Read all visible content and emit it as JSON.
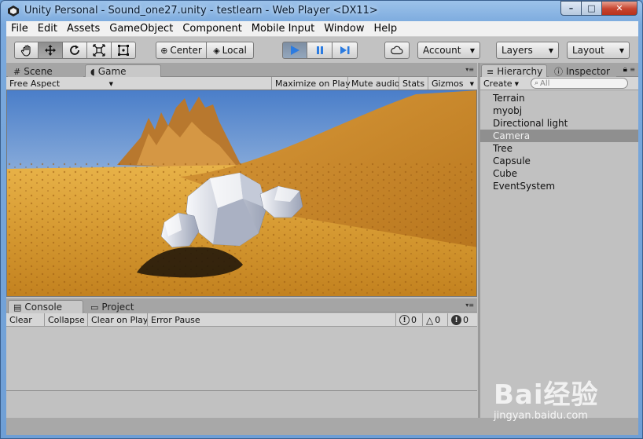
{
  "window": {
    "title": "Unity Personal - Sound_one27.unity - testlearn - Web Player <DX11>",
    "controls": {
      "minimize": "–",
      "maximize": "□",
      "close": "✕"
    }
  },
  "menu": [
    "File",
    "Edit",
    "Assets",
    "GameObject",
    "Component",
    "Mobile Input",
    "Window",
    "Help"
  ],
  "toolbar": {
    "tools": [
      "hand-icon",
      "move-icon",
      "rotate-icon",
      "scale-icon",
      "rect-tool-icon"
    ],
    "pivot_center": "Center",
    "pivot_local": "Local",
    "play_controls": [
      "play-icon",
      "pause-icon",
      "step-icon"
    ],
    "account": "Account",
    "layers": "Layers",
    "layout": "Layout"
  },
  "center_tabs": {
    "scene": "Scene",
    "game": "Game"
  },
  "game_bar": {
    "aspect": "Free Aspect",
    "maximize_on_play": "Maximize on Play",
    "mute_audio": "Mute audio",
    "stats": "Stats",
    "gizmos": "Gizmos"
  },
  "right_tabs": {
    "hierarchy": "Hierarchy",
    "inspector": "Inspector"
  },
  "hierarchy": {
    "create": "Create",
    "search_placeholder": "All",
    "items": [
      "Terrain",
      "myobj",
      "Directional light",
      "Camera",
      "Tree",
      "Capsule",
      "Cube",
      "EventSystem"
    ],
    "selected": "Camera"
  },
  "bottom_tabs": {
    "console": "Console",
    "project": "Project"
  },
  "console_bar": {
    "clear": "Clear",
    "collapse": "Collapse",
    "clear_on_play": "Clear on Play",
    "error_pause": "Error Pause",
    "info_count": "0",
    "warning_count": "0",
    "error_count": "0"
  },
  "watermark": {
    "brand": "Bai经验",
    "url": "jingyan.baidu.com"
  },
  "colors": {
    "play_blue": "#2b7be0",
    "selection": "#8f8f8f"
  }
}
